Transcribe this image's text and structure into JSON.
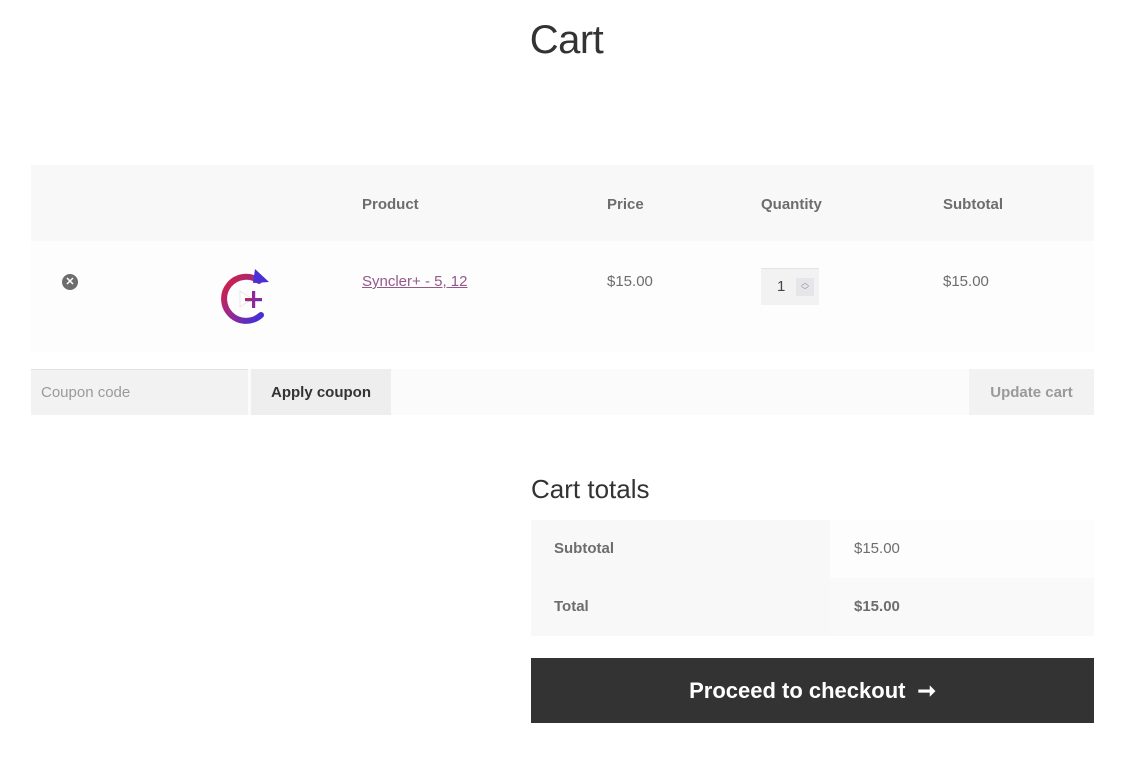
{
  "page": {
    "title": "Cart"
  },
  "cart_table": {
    "headers": [
      "",
      "",
      "Product",
      "Price",
      "Quantity",
      "Subtotal"
    ],
    "rows": [
      {
        "remove_icon": "remove-circle-x-icon",
        "thumbnail_icon": "syncler-plus-logo",
        "product": "Syncler+ - 5, 12",
        "price": "$15.00",
        "quantity": "1",
        "subtotal": "$15.00"
      }
    ]
  },
  "actions": {
    "coupon_placeholder": "Coupon code",
    "coupon_value": "",
    "apply_label": "Apply coupon",
    "update_label": "Update cart"
  },
  "totals": {
    "title": "Cart totals",
    "rows": [
      {
        "label": "Subtotal",
        "value": "$15.00"
      },
      {
        "label": "Total",
        "value": "$15.00"
      }
    ],
    "checkout_label": "Proceed to checkout",
    "checkout_icon": "arrow-right-icon"
  },
  "colors": {
    "link": "#96588a",
    "button_dark": "#333333",
    "logo_gradient_start": "#d81e3c",
    "logo_gradient_end": "#3b2fe0"
  }
}
